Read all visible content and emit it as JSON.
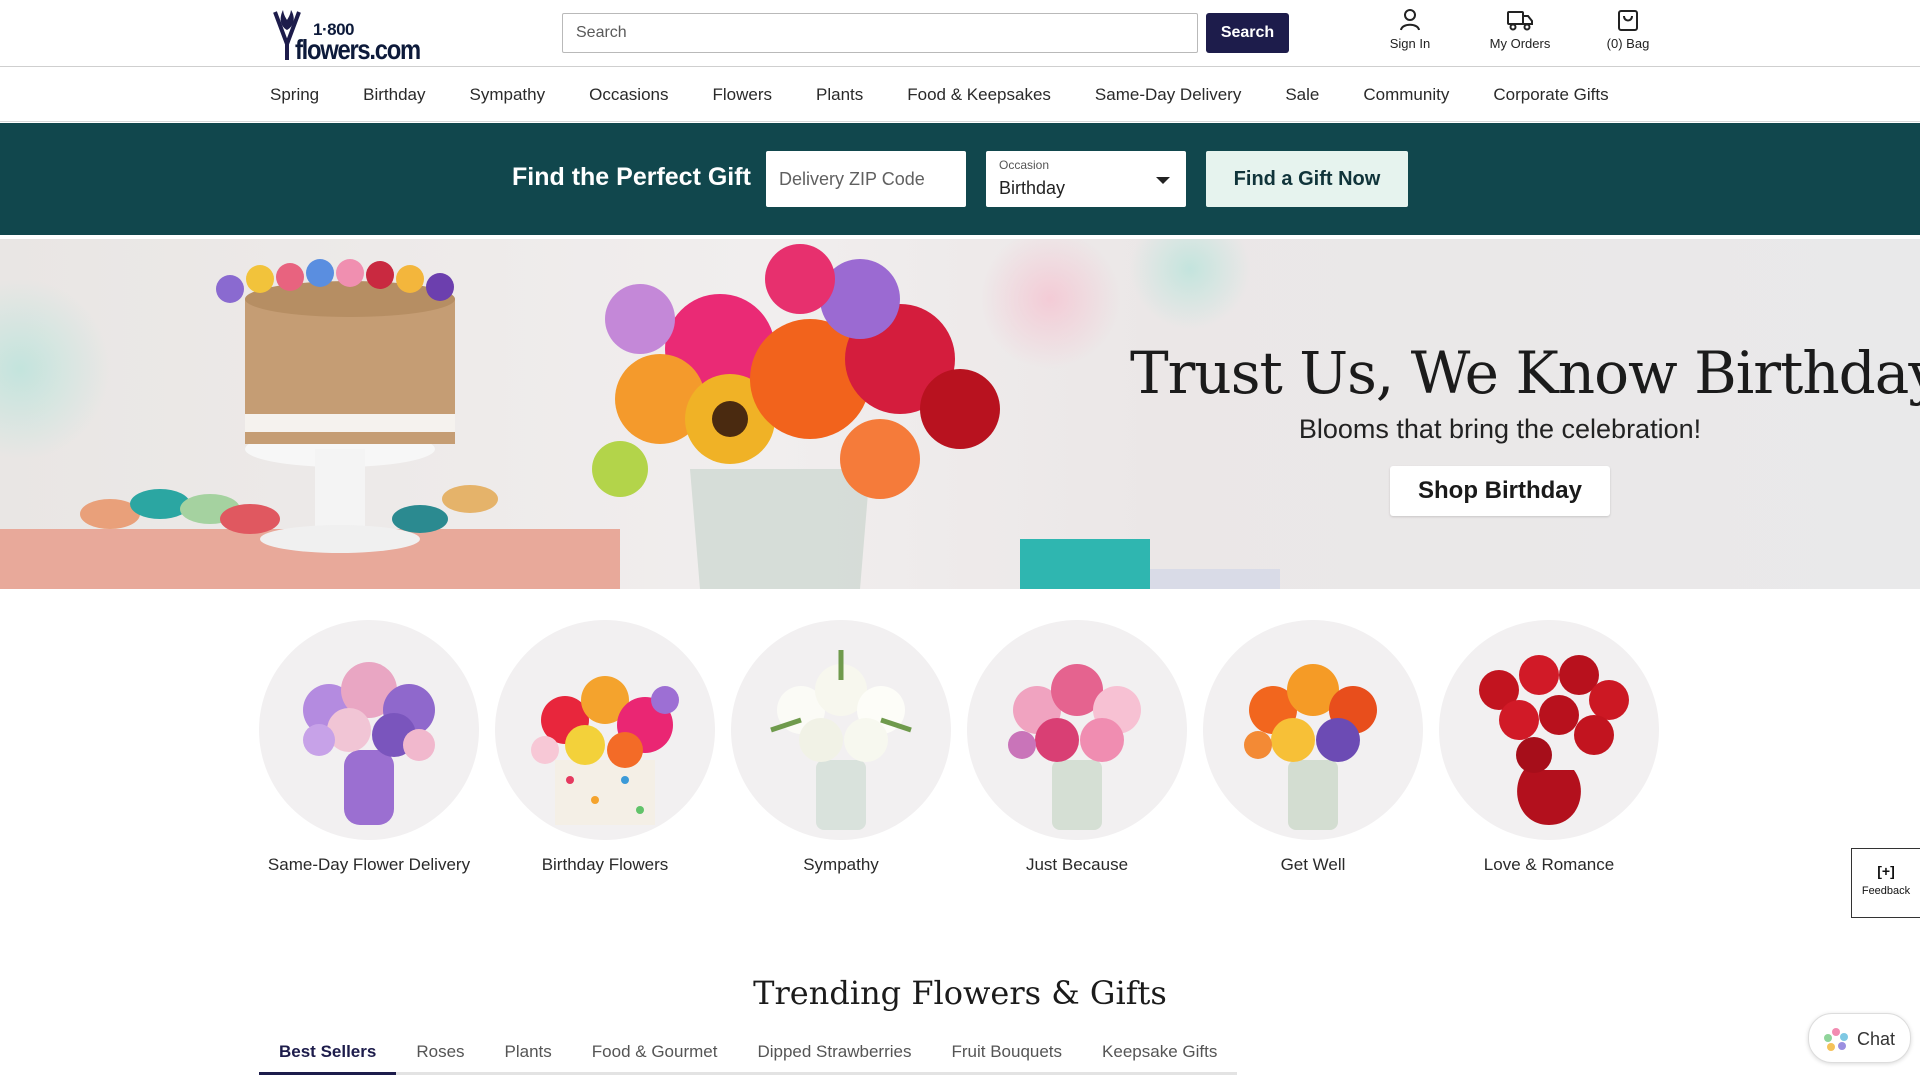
{
  "header": {
    "logo_text_top": "1·800",
    "logo_text_main": "flowers.com",
    "search_placeholder": "Search",
    "search_button": "Search",
    "sign_in": "Sign In",
    "my_orders": "My Orders",
    "bag": "(0) Bag"
  },
  "nav": {
    "items": [
      "Spring",
      "Birthday",
      "Sympathy",
      "Occasions",
      "Flowers",
      "Plants",
      "Food & Keepsakes",
      "Same-Day Delivery",
      "Sale",
      "Community",
      "Corporate Gifts"
    ]
  },
  "gift_finder": {
    "title": "Find the Perfect Gift",
    "zip_placeholder": "Delivery ZIP Code",
    "occasion_label": "Occasion",
    "occasion_value": "Birthday",
    "button": "Find a Gift Now"
  },
  "hero": {
    "title": "Trust Us, We Know Birthdays",
    "subtitle": "Blooms that bring the celebration!",
    "button": "Shop Birthday"
  },
  "categories": [
    {
      "name": "Same-Day Flower Delivery"
    },
    {
      "name": "Birthday Flowers"
    },
    {
      "name": "Sympathy"
    },
    {
      "name": "Just Because"
    },
    {
      "name": "Get Well"
    },
    {
      "name": "Love & Romance"
    }
  ],
  "trending": {
    "title": "Trending Flowers & Gifts",
    "tabs": [
      "Best Sellers",
      "Roses",
      "Plants",
      "Food & Gourmet",
      "Dipped Strawberries",
      "Fruit Bouquets",
      "Keepsake Gifts"
    ],
    "active_tab": "Best Sellers"
  },
  "feedback": {
    "icon": "[+]",
    "label": "Feedback"
  },
  "chat": {
    "label": "Chat"
  },
  "colors": {
    "brand_navy": "#1d1c4b",
    "finder_bg": "#11474d",
    "find_button_bg": "#e6f3ee"
  }
}
